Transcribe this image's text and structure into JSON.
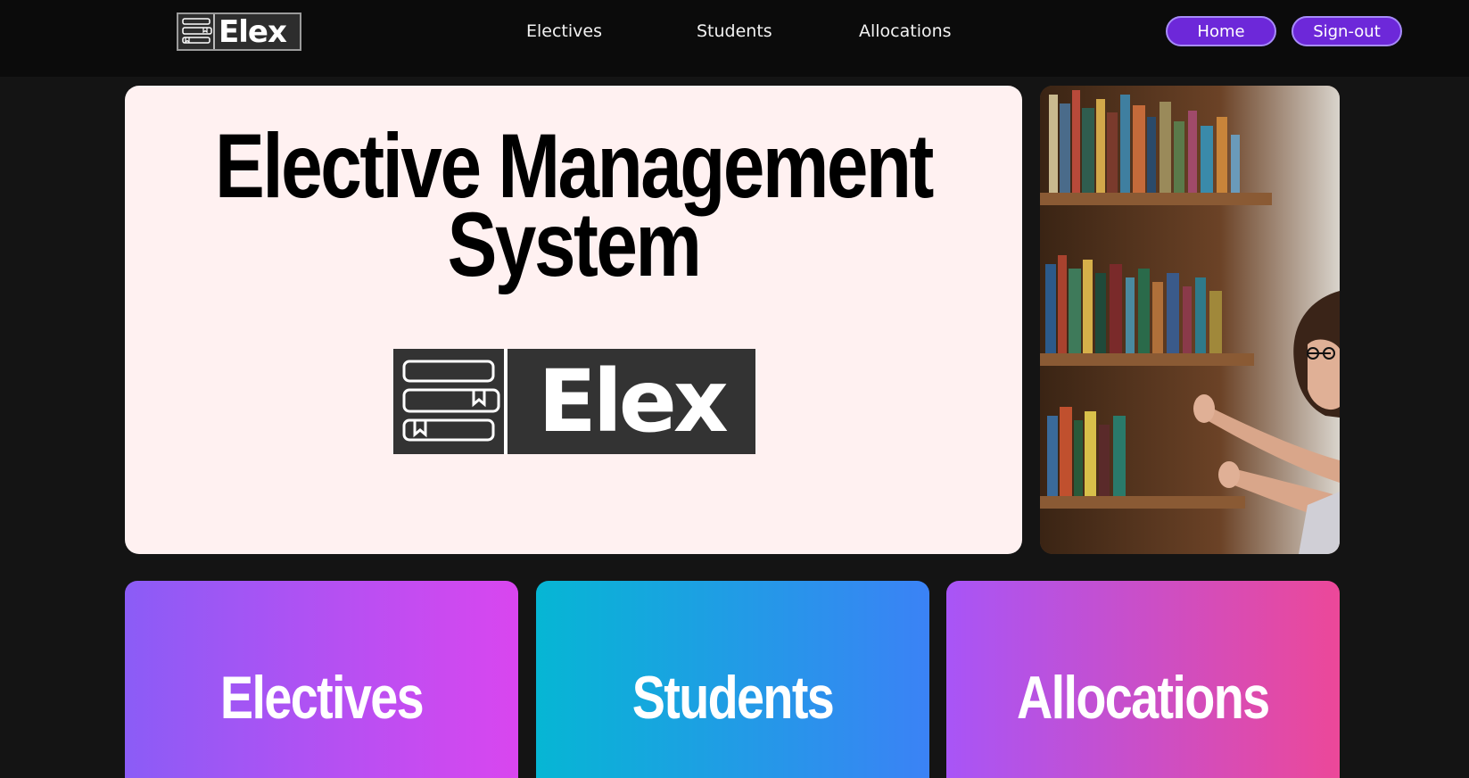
{
  "brand": {
    "name": "Elex"
  },
  "nav": {
    "links": [
      "Electives",
      "Students",
      "Allocations"
    ],
    "home_label": "Home",
    "signout_label": "Sign-out"
  },
  "hero": {
    "title_line1": "Elective Management",
    "title_line2": "System",
    "logo_text": "Elex"
  },
  "cards": [
    "Electives",
    "Students",
    "Allocations"
  ],
  "colors": {
    "accent": "#6d28d9",
    "background": "#141414",
    "hero_bg": "#fff1f1"
  },
  "icons": [
    "books-logo-icon"
  ]
}
